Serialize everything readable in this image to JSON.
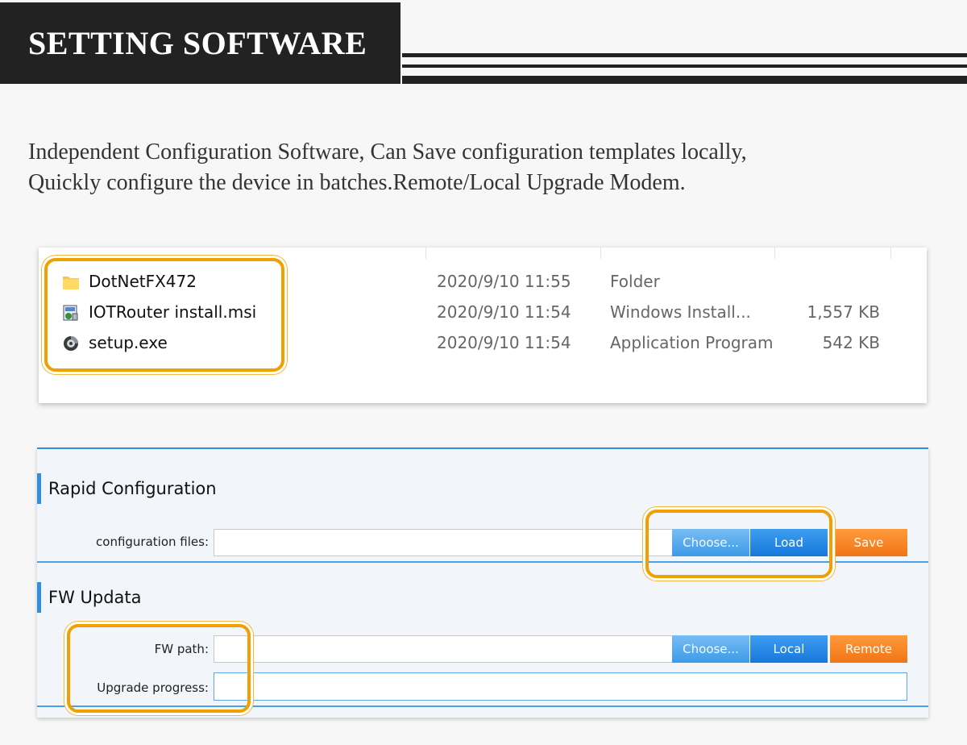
{
  "header": {
    "title": "SETTING SOFTWARE"
  },
  "intro": {
    "line1": "Independent Configuration Software, Can Save configuration templates locally,",
    "line2": "Quickly configure the device in batches.Remote/Local Upgrade Modem."
  },
  "files": [
    {
      "name": "DotNetFX472",
      "date": "2020/9/10 11:55",
      "type": "Folder",
      "size": "",
      "icon": "folder-icon"
    },
    {
      "name": "IOTRouter install.msi",
      "date": "2020/9/10 11:54",
      "type": "Windows Install...",
      "size": "1,557 KB",
      "icon": "installer-icon"
    },
    {
      "name": "setup.exe",
      "date": "2020/9/10 11:54",
      "type": "Application Program",
      "size": "542 KB",
      "icon": "setup-icon"
    }
  ],
  "rapid": {
    "title": "Rapid Configuration",
    "config_label": "configuration files:",
    "config_value": "",
    "choose_label": "Choose...",
    "load_label": "Load",
    "save_label": "Save"
  },
  "fw": {
    "title": "FW Updata",
    "path_label": "FW path:",
    "path_value": "",
    "progress_label": "Upgrade progress:",
    "choose_label": "Choose...",
    "local_label": "Local",
    "remote_label": "Remote"
  },
  "colors": {
    "highlight": "#f0a000",
    "accent_blue": "#2f8fe0",
    "button_orange": "#f07516",
    "banner": "#222222"
  }
}
